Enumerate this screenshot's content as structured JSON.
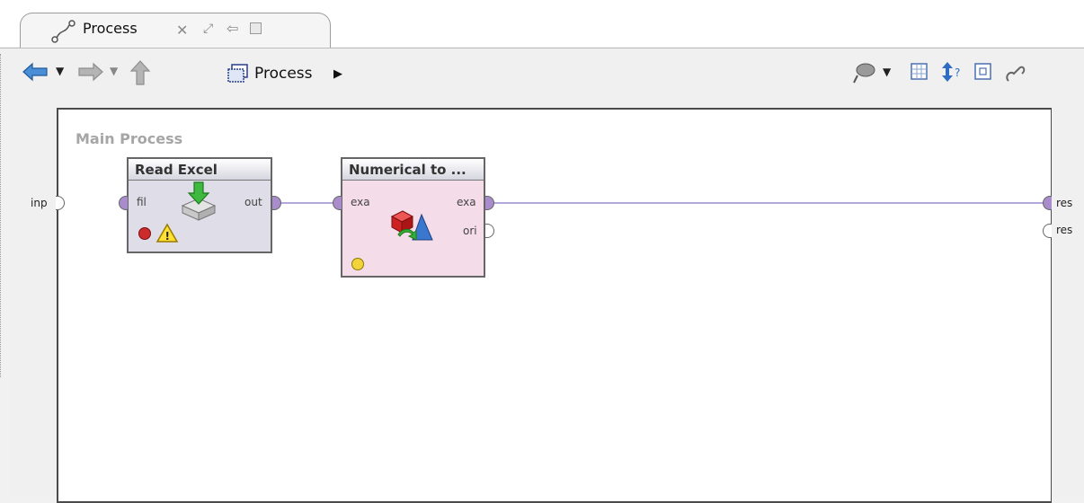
{
  "tab": {
    "title": "Process"
  },
  "breadcrumb": {
    "label": "Process"
  },
  "canvas": {
    "label": "Main Process"
  },
  "ports": {
    "input": "inp",
    "result1": "res",
    "result2": "res"
  },
  "operators": [
    {
      "title": "Read Excel",
      "in_port": "fil",
      "out_ports": [
        "out"
      ]
    },
    {
      "title": "Numerical to ...",
      "in_port": "exa",
      "out_ports": [
        "exa",
        "ori"
      ]
    }
  ],
  "colors": {
    "connection": "#9a8cd0",
    "read_excel_bg": "#dedde8",
    "numerical_bg": "#f4dce8",
    "port_fill": "#a88ccc"
  },
  "icons": [
    "tab-process-icon",
    "close-icon",
    "maximize-icon",
    "undock-icon",
    "restore-icon",
    "back-arrow-icon",
    "dropdown-icon",
    "forward-arrow-icon",
    "up-arrow-icon",
    "process-icon",
    "breadcrumb-arrow-icon",
    "wand-icon",
    "grid-icon",
    "layout-icon",
    "fit-icon",
    "link-icon",
    "excel-import-icon",
    "convert-icon",
    "error-dot-icon",
    "warning-icon",
    "status-dot-icon"
  ]
}
